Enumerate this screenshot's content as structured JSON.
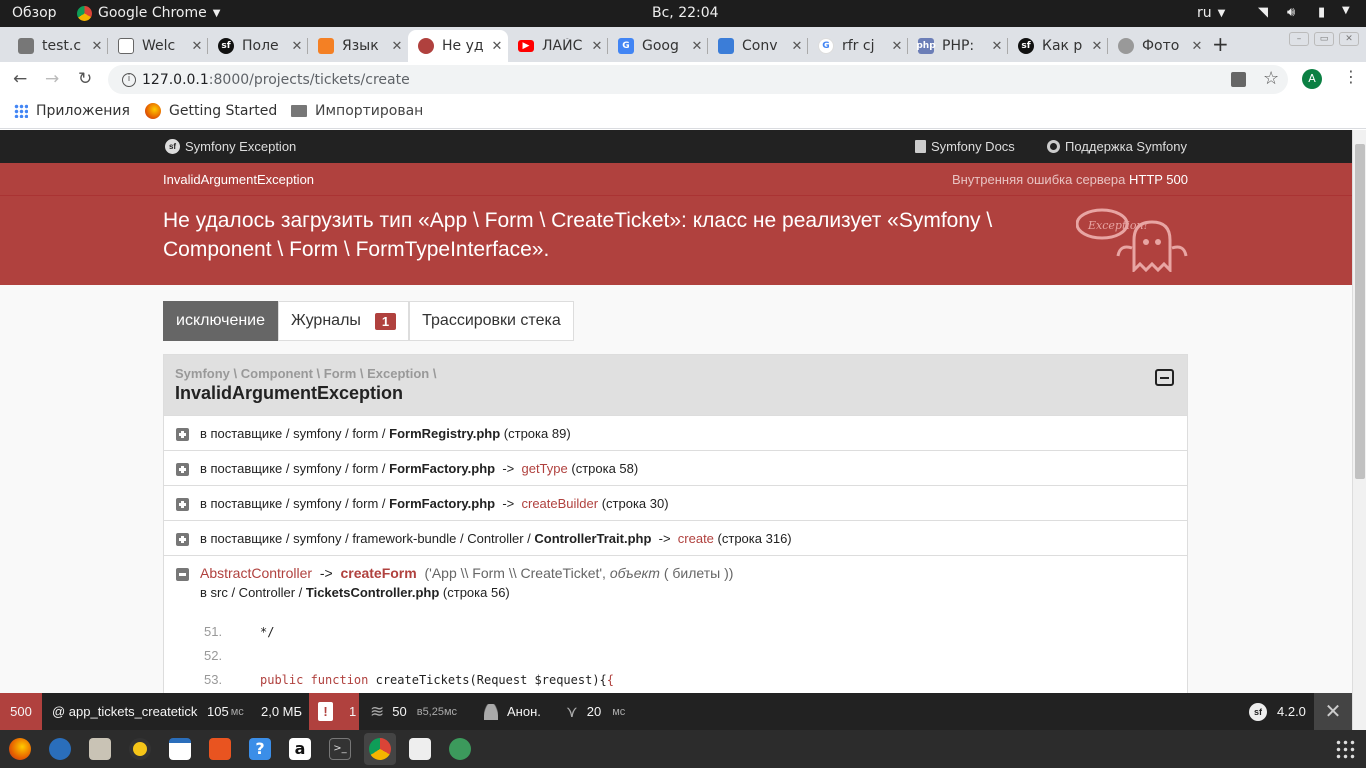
{
  "system": {
    "activities": "Обзор",
    "app_name": "Google Chrome",
    "clock": "Вс, 22:04",
    "lang": "ru"
  },
  "tabs": [
    {
      "title": "test.c",
      "color": "#777"
    },
    {
      "title": "Welc",
      "color": "#888"
    },
    {
      "title": "Поле",
      "color": "#111"
    },
    {
      "title": "Язык",
      "color": "#f48024"
    },
    {
      "title": "Не уд",
      "color": "#b0413e"
    },
    {
      "title": "ЛАЙС",
      "color": "#ff0000"
    },
    {
      "title": "Goog",
      "color": "#4285f4"
    },
    {
      "title": "Conv",
      "color": "#3b5998"
    },
    {
      "title": "rfr cj",
      "color": "#4285f4"
    },
    {
      "title": "PHP:",
      "color": "#6c7eb7"
    },
    {
      "title": "Как р",
      "color": "#111"
    },
    {
      "title": "Фото",
      "color": "#999"
    }
  ],
  "address": {
    "host": "127.0.0.1",
    "path": ":8000/projects/tickets/create",
    "avatar": "A"
  },
  "bookmarks": {
    "apps": "Приложения",
    "getting_started": "Getting Started",
    "imported": "Импортирован"
  },
  "sf": {
    "brand": "Symfony Exception",
    "docs": "Symfony Docs",
    "support": "Поддержка Symfony",
    "exception_class": "InvalidArgumentException",
    "status_text": "Внутренняя ошибка сервера",
    "status_code": "HTTP 500",
    "message": "Не удалось загрузить тип «App \\ Form \\ CreateTicket»: класс не реализует «Symfony \\ Component \\ Form \\ FormTypeInterface».",
    "tab_exception": "исключение",
    "tab_logs": "Журналы",
    "logs_count": "1",
    "tab_traces": "Трассировки стека",
    "ex_namespace": "Symfony \\ Component \\ Form \\ Exception \\",
    "ex_name": "InvalidArgumentException",
    "traces": [
      {
        "prefix": "в поставщике / symfony / form / ",
        "file": "FormRegistry.php",
        "method": "",
        "line": "(строка 89)"
      },
      {
        "prefix": "в поставщике / symfony / form / ",
        "file": "FormFactory.php",
        "method": "getType",
        "line": "(строка 58)"
      },
      {
        "prefix": "в поставщике / symfony / form / ",
        "file": "FormFactory.php",
        "method": "createBuilder",
        "line": "(строка 30)"
      },
      {
        "prefix": "в поставщике / symfony / framework-bundle / Controller / ",
        "file": "ControllerTrait.php",
        "method": "create",
        "line": "(строка 316)"
      }
    ],
    "open_trace": {
      "cls": "AbstractController",
      "method": "createForm",
      "args": "('App \\\\ Form \\\\ CreateTicket', ",
      "obj": "объект",
      "args_end": " ( билеты ))",
      "loc_prefix": "в src / Controller / ",
      "loc_file": "TicketsController.php",
      "loc_line": "(строка 56)"
    },
    "code": [
      {
        "n": "51.",
        "text": "*/"
      },
      {
        "n": "52.",
        "text": ""
      },
      {
        "n": "53.",
        "kw": "public function ",
        "text": "createTickets(Request $request){"
      }
    ]
  },
  "toolbar": {
    "status": "500",
    "route": "@ app_tickets_createticket",
    "time": "105",
    "time_unit": "мс",
    "memory": "2,0 МБ",
    "errors": "1",
    "db": "50",
    "db_unit": "в5,25мс",
    "user": "Анон.",
    "twig": "20",
    "twig_unit": "мс",
    "version": "4.2.0"
  }
}
